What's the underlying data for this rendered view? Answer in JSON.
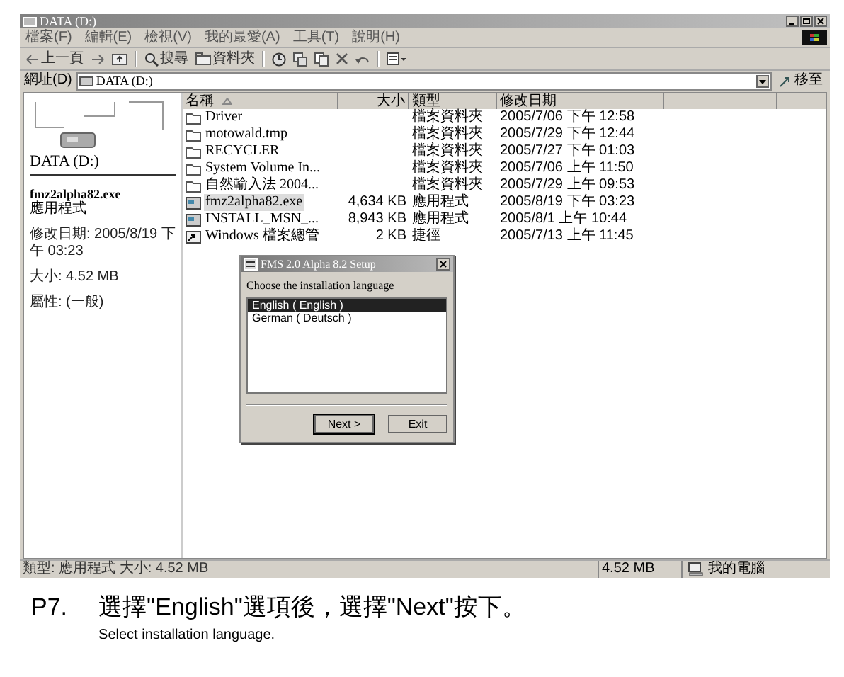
{
  "window": {
    "title": "DATA (D:)"
  },
  "menu": [
    "檔案(F)",
    "編輯(E)",
    "檢視(V)",
    "我的最愛(A)",
    "工具(T)",
    "說明(H)"
  ],
  "toolbar": [
    {
      "kind": "back",
      "label": "上一頁"
    },
    {
      "kind": "forward"
    },
    {
      "kind": "up"
    },
    {
      "kind": "search",
      "label": "搜尋"
    },
    {
      "kind": "folders",
      "label": "資料夾"
    },
    {
      "kind": "history"
    },
    {
      "kind": "move"
    },
    {
      "kind": "copy"
    },
    {
      "kind": "delete"
    },
    {
      "kind": "undo"
    },
    {
      "kind": "views"
    }
  ],
  "address": {
    "label": "網址(D)",
    "value": "DATA (D:)",
    "go": "移至"
  },
  "side_panel": {
    "drive": "DATA (D:)",
    "file_name": "fmz2alpha82.exe",
    "file_type": "應用程式",
    "modified": "修改日期: 2005/8/19 下午 03:23",
    "size": "大小: 4.52 MB",
    "attributes": "屬性: (一般)"
  },
  "columns": [
    "名稱",
    "大小",
    "類型",
    "修改日期"
  ],
  "files": [
    {
      "kind": "folder",
      "name": "Driver",
      "type": "檔案資料夾",
      "date": "2005/7/06 下午 12:58",
      "selected": false
    },
    {
      "kind": "folder",
      "name": "motowald.tmp",
      "type": "檔案資料夾",
      "date": "2005/7/29 下午 12:44",
      "selected": false
    },
    {
      "kind": "folder",
      "name": "RECYCLER",
      "type": "檔案資料夾",
      "date": "2005/7/27 下午 01:03",
      "selected": false
    },
    {
      "kind": "folder",
      "name": "System Volume In...",
      "type": "檔案資料夾",
      "date": "2005/7/06 上午 11:50",
      "selected": false
    },
    {
      "kind": "folder",
      "name": "自然輸入法 2004...",
      "type": "檔案資料夾",
      "date": "2005/7/29 上午 09:53",
      "selected": false
    },
    {
      "kind": "app",
      "name": "fmz2alpha82.exe",
      "size": "4,634 KB",
      "type": "應用程式",
      "date": "2005/8/19 下午 03:23",
      "selected": true
    },
    {
      "kind": "app",
      "name": "INSTALL_MSN_...",
      "size": "8,943 KB",
      "type": "應用程式",
      "date": "2005/8/1 上午 10:44",
      "selected": false
    },
    {
      "kind": "shortcut",
      "name": "Windows 檔案總管",
      "size": "2 KB",
      "type": "捷徑",
      "date": "2005/7/13 上午 11:45",
      "selected": false
    }
  ],
  "dialog": {
    "title": "FMS 2.0 Alpha 8.2 Setup",
    "prompt": "Choose the installation language",
    "languages": [
      {
        "label": "English  ( English )",
        "selected": true
      },
      {
        "label": "German  ( Deutsch )",
        "selected": false
      }
    ],
    "buttons": [
      "Next >",
      "Exit"
    ]
  },
  "status_bar": {
    "text": "類型: 應用程式 大小: 4.52 MB",
    "size": "4.52 MB",
    "zone": "我的電腦"
  },
  "caption": {
    "step": "P7.",
    "text": "選擇\"English\"選項後，選擇\"Next\"按下。",
    "subtext": "Select installation language."
  }
}
